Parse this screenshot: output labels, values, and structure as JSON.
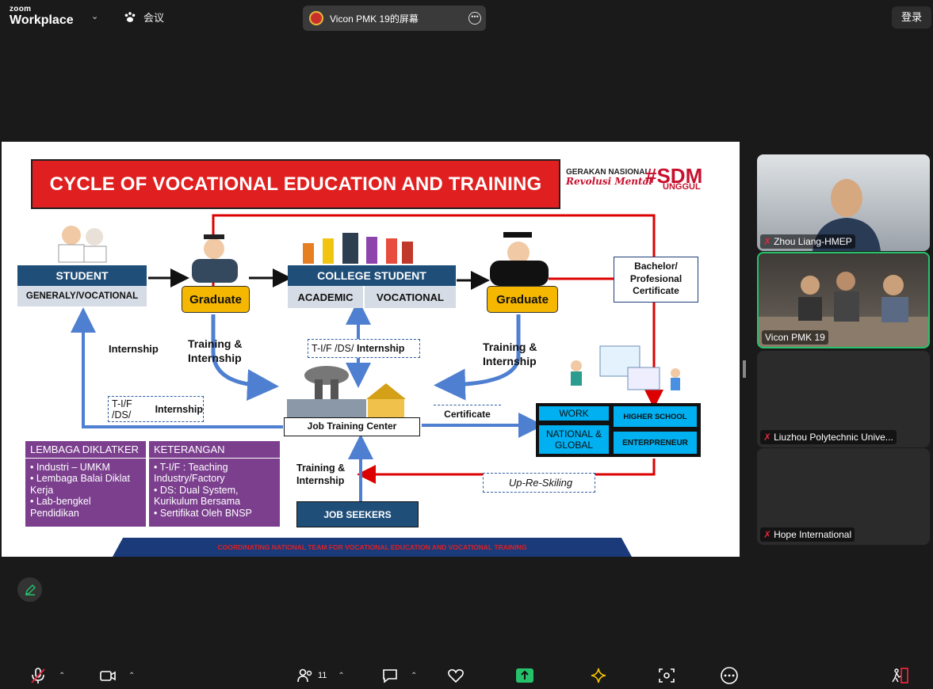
{
  "topbar": {
    "brand_small": "zoom",
    "brand_large": "Workplace",
    "meeting_label": "会议",
    "share_title": "Vicon PMK 19的屏幕",
    "login": "登录"
  },
  "slide": {
    "title": "CYCLE OF VOCATIONAL EDUCATION AND TRAINING",
    "logo_line1": "GERAKAN NASIONAL",
    "logo_line2": "Revolusi Mental",
    "logo_tag": "#SDM",
    "logo_tag_sub": "UNGGUL",
    "student": "STUDENT",
    "student_sub": "GENERALY/VOCATIONAL",
    "graduate": "Graduate",
    "college": "COLLEGE STUDENT",
    "academic": "ACADEMIC",
    "vocational": "VOCATIONAL",
    "bachelor": "Bachelor/ Profesional Certificate",
    "internship": "Internship",
    "training_internship": "Training & Internship",
    "tifds": "T-I/F /DS/",
    "tifds_internship": "Internship",
    "tifds2": "T-I/F /DS/",
    "job_center": "Job Training Center",
    "certificate": "Certificate",
    "work": "WORK",
    "higher_school": "HIGHER SCHOOL",
    "national_global": "NATIONAL & GLOBAL",
    "entrepreneur": "ENTERPRENEUR",
    "up_reskilling": "Up-Re-Skiling",
    "job_seekers": "JOB SEEKERS",
    "lembaga_title": "LEMBAGA DIKLATKER",
    "lembaga_items": [
      "Industri – UMKM",
      "Lembaga Balai Diklat Kerja",
      "Lab-bengkel Pendidikan"
    ],
    "keterangan_title": "KETERANGAN",
    "keterangan_items": [
      "T-I/F : Teaching Industry/Factory",
      "DS: Dual System, Kurikulum Bersama",
      "Sertifikat Oleh BNSP"
    ],
    "footer": "COORDINATING NATIONAL TEAM FOR VOCATIONAL EDUCATION AND VOCATIONAL TRAINING"
  },
  "participants": [
    {
      "name": "Zhou Liang-HMEP",
      "muted": true
    },
    {
      "name": "Vicon PMK 19",
      "muted": false
    },
    {
      "name": "Liuzhou Polytechnic Unive...",
      "muted": true
    },
    {
      "name": "Hope International",
      "muted": true
    }
  ],
  "toolbar": {
    "participant_count": "11"
  },
  "colors": {
    "accent_green": "#25c26b",
    "title_red": "#e02020",
    "navy": "#1f4e79",
    "gold": "#f5b700",
    "cyan": "#00b0f0",
    "purple": "#7b3f8e"
  }
}
